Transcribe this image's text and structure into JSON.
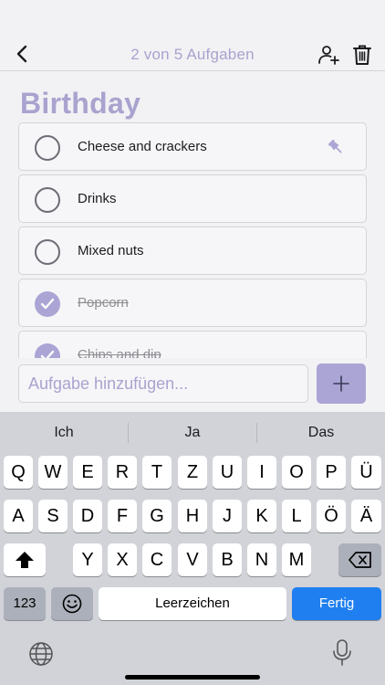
{
  "header": {
    "title": "2 von 5 Aufgaben",
    "back_icon": "chevron-left-icon",
    "share_icon": "person-add-icon",
    "trash_icon": "trash-icon"
  },
  "list": {
    "title": "Birthday",
    "tasks": [
      {
        "label": "Cheese and crackers",
        "done": false,
        "pinned": true
      },
      {
        "label": "Drinks",
        "done": false,
        "pinned": false
      },
      {
        "label": "Mixed nuts",
        "done": false,
        "pinned": false
      },
      {
        "label": "Popcorn",
        "done": true,
        "pinned": false
      },
      {
        "label": "Chips and dip",
        "done": true,
        "pinned": false
      }
    ]
  },
  "input": {
    "placeholder": "Aufgabe hinzufügen...",
    "value": ""
  },
  "add_button": {
    "icon": "plus-icon"
  },
  "keyboard": {
    "suggestions": [
      "Ich",
      "Ja",
      "Das"
    ],
    "row1": [
      "Q",
      "W",
      "E",
      "R",
      "T",
      "Z",
      "U",
      "I",
      "O",
      "P",
      "Ü"
    ],
    "row2": [
      "A",
      "S",
      "D",
      "F",
      "G",
      "H",
      "J",
      "K",
      "L",
      "Ö",
      "Ä"
    ],
    "row3": [
      "Y",
      "X",
      "C",
      "V",
      "B",
      "N",
      "M"
    ],
    "numbers_label": "123",
    "space_label": "Leerzeichen",
    "done_label": "Fertig"
  },
  "colors": {
    "accent": "#aaa5d4",
    "accent_text": "#a9a3cf",
    "done_button": "#1f7ff0"
  }
}
